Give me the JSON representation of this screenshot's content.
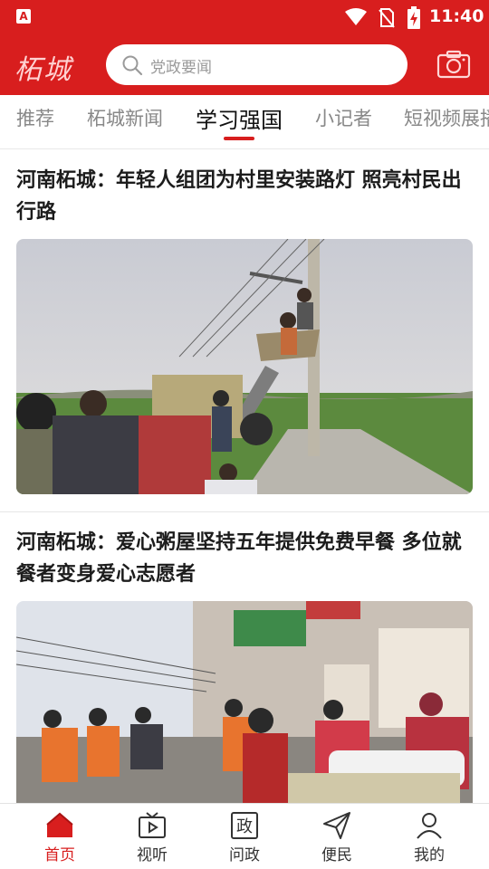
{
  "status_bar": {
    "time": "11:40"
  },
  "header": {
    "logo_text": "柘城",
    "search_placeholder": "党政要闻",
    "camera_icon": "camera-icon",
    "accent": "#d81e1e"
  },
  "tabs": [
    {
      "label": "推荐",
      "active": false
    },
    {
      "label": "柘城新闻",
      "active": false
    },
    {
      "label": "学习强国",
      "active": true
    },
    {
      "label": "小记者",
      "active": false
    },
    {
      "label": "短视频展播",
      "active": false
    }
  ],
  "articles": [
    {
      "title": "河南柘城：年轻人组团为村里安装路灯 照亮村民出行路"
    },
    {
      "title": "河南柘城：爱心粥屋坚持五年提供免费早餐 多位就餐者变身爱心志愿者"
    }
  ],
  "bottom_nav": [
    {
      "label": "首页",
      "icon": "home-icon",
      "active": true
    },
    {
      "label": "视听",
      "icon": "tv-icon",
      "active": false
    },
    {
      "label": "问政",
      "icon": "zheng-icon",
      "active": false
    },
    {
      "label": "便民",
      "icon": "paper-plane-icon",
      "active": false
    },
    {
      "label": "我的",
      "icon": "person-icon",
      "active": false
    }
  ]
}
